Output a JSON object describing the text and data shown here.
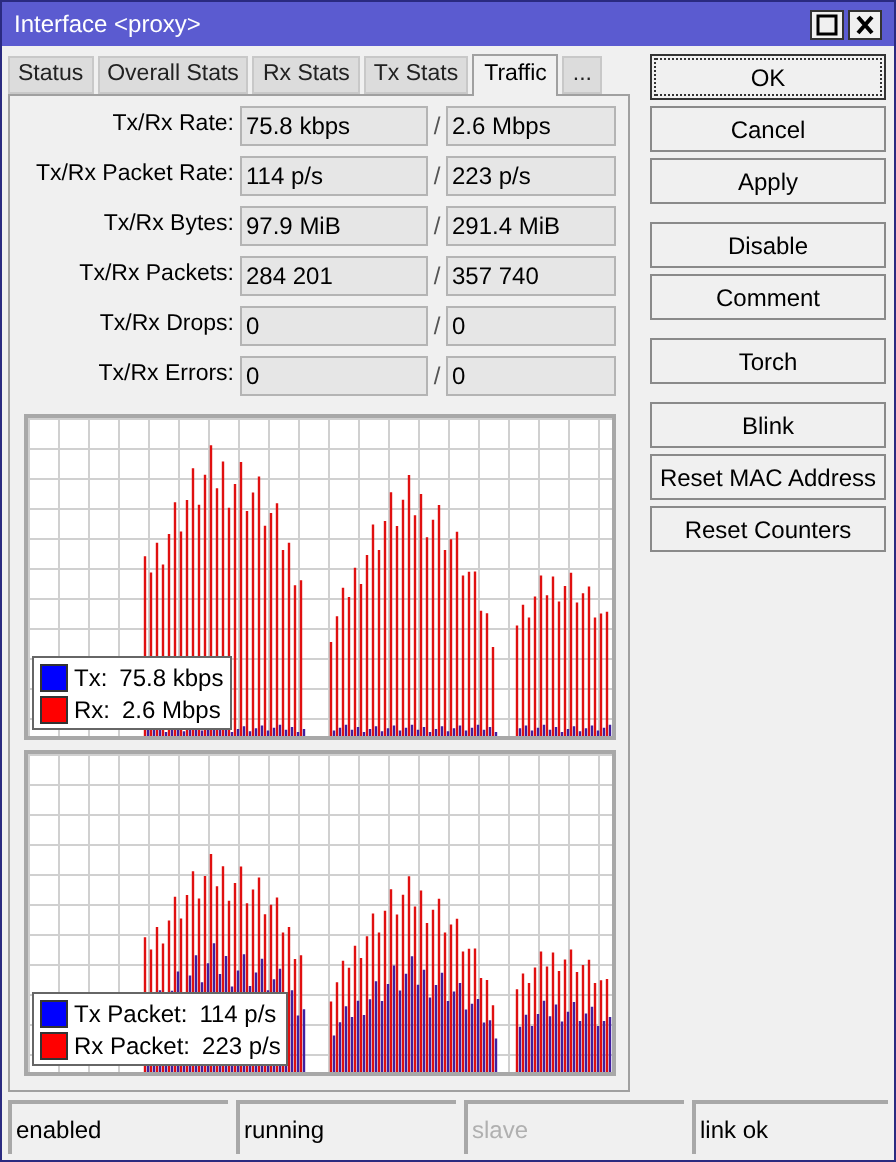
{
  "window": {
    "title": "Interface <proxy>"
  },
  "tabs": [
    {
      "label": "Status",
      "selected": false
    },
    {
      "label": "Overall Stats",
      "selected": false
    },
    {
      "label": "Rx Stats",
      "selected": false
    },
    {
      "label": "Tx Stats",
      "selected": false
    },
    {
      "label": "Traffic",
      "selected": true
    },
    {
      "label": "...",
      "selected": false
    }
  ],
  "fields": [
    {
      "label": "Tx/Rx Rate:",
      "tx": "75.8 kbps",
      "separator": "/",
      "rx": "2.6 Mbps"
    },
    {
      "label": "Tx/Rx Packet Rate:",
      "tx": "114 p/s",
      "separator": "/",
      "rx": "223 p/s"
    },
    {
      "label": "Tx/Rx Bytes:",
      "tx": "97.9 MiB",
      "separator": "/",
      "rx": "291.4 MiB"
    },
    {
      "label": "Tx/Rx Packets:",
      "tx": "284 201",
      "separator": "/",
      "rx": "357 740"
    },
    {
      "label": "Tx/Rx Drops:",
      "tx": "0",
      "separator": "/",
      "rx": "0"
    },
    {
      "label": "Tx/Rx Errors:",
      "tx": "0",
      "separator": "/",
      "rx": "0"
    }
  ],
  "buttons": [
    {
      "label": "OK",
      "focused": true
    },
    {
      "label": "Cancel",
      "focused": false
    },
    {
      "label": "Apply",
      "focused": false
    },
    {
      "label": "Disable",
      "focused": false
    },
    {
      "label": "Comment",
      "focused": false
    },
    {
      "label": "Torch",
      "focused": false
    },
    {
      "label": "Blink",
      "focused": false
    },
    {
      "label": "Reset MAC Address",
      "focused": false
    },
    {
      "label": "Reset Counters",
      "focused": false
    }
  ],
  "graphs": [
    {
      "legend": [
        {
          "label": "Tx:",
          "value": "75.8 kbps",
          "color": "#0000ff"
        },
        {
          "label": "Rx:",
          "value": "2.6 Mbps",
          "color": "#ff0000"
        }
      ]
    },
    {
      "legend": [
        {
          "label": "Tx Packet:",
          "value": "114 p/s",
          "color": "#0000ff"
        },
        {
          "label": "Rx Packet:",
          "value": "223 p/s",
          "color": "#ff0000"
        }
      ]
    }
  ],
  "status_bar": [
    {
      "text": "enabled",
      "disabled": false
    },
    {
      "text": "running",
      "disabled": false
    },
    {
      "text": "slave",
      "disabled": true
    },
    {
      "text": "link ok",
      "disabled": false
    }
  ]
}
